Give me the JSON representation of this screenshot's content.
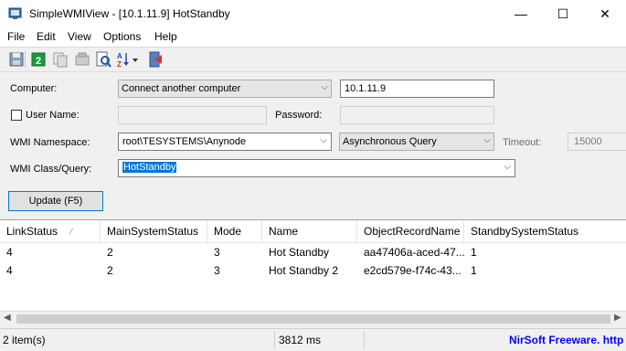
{
  "window": {
    "title": "SimpleWMIView  -  [10.1.11.9]  HotStandby",
    "minimize_glyph": "—",
    "maximize_glyph": "☐",
    "close_glyph": "✕"
  },
  "menu": {
    "items": [
      {
        "label": "File"
      },
      {
        "label": "Edit"
      },
      {
        "label": "View"
      },
      {
        "label": "Options"
      },
      {
        "label": "Help"
      }
    ]
  },
  "toolbar": {
    "buttons": [
      "save-icon",
      "refresh-icon",
      "copy-icon",
      "properties-icon",
      "find-icon",
      "sort-az-icon",
      "exit-icon"
    ]
  },
  "form": {
    "computer_label": "Computer:",
    "computer_combo_value": "Connect another computer",
    "computer_address": "10.1.11.9",
    "username_label": "User Name:",
    "username_value": "",
    "password_label": "Password:",
    "password_value": "",
    "namespace_label": "WMI Namespace:",
    "namespace_value": "root\\TESYSTEMS\\Anynode",
    "query_mode": "Asynchronous Query",
    "timeout_label": "Timeout:",
    "timeout_value": "15000",
    "class_label": "WMI Class/Query:",
    "class_value": "HotStandby",
    "update_button": "Update (F5)"
  },
  "table": {
    "columns": [
      "LinkStatus",
      "MainSystemStatus",
      "Mode",
      "Name",
      "ObjectRecordName",
      "StandbySystemStatus"
    ],
    "rows": [
      [
        "4",
        "2",
        "3",
        "Hot Standby",
        "aa47406a-aced-47...",
        "1"
      ],
      [
        "4",
        "2",
        "3",
        "Hot Standby 2",
        "e2cd579e-f74c-43...",
        "1"
      ]
    ]
  },
  "status": {
    "items_count": "2 item(s)",
    "elapsed": "3812 ms",
    "credit": "NirSoft Freeware. http"
  },
  "colors": {
    "selection": "#0078d7",
    "link": "#0000ff"
  }
}
